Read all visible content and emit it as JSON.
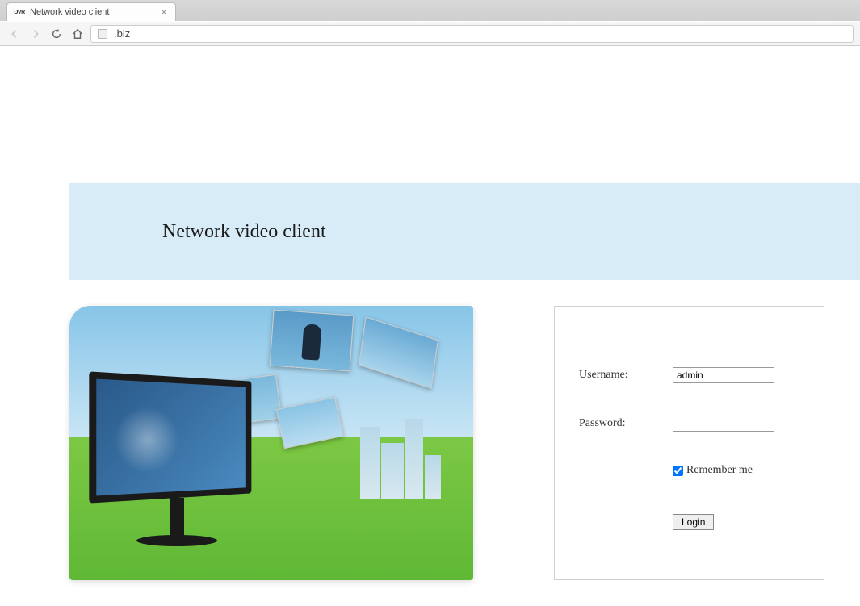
{
  "browser": {
    "tab": {
      "favicon_text": "DVR",
      "title": "Network video client"
    },
    "url": ".biz"
  },
  "page": {
    "banner_title": "Network video client",
    "login": {
      "username_label": "Username:",
      "username_value": "admin",
      "password_label": "Password:",
      "password_value": "",
      "remember_label": "Remember me",
      "remember_checked": true,
      "submit_label": "Login"
    }
  }
}
